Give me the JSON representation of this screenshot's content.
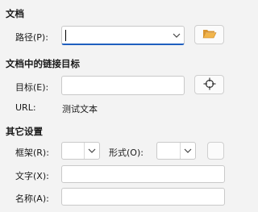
{
  "document": {
    "section_title": "文档",
    "path_label": "路径(P):",
    "path_value": ""
  },
  "target_section": {
    "section_title": "文档中的链接目标",
    "target_label": "目标(E):",
    "target_value": "",
    "url_label": "URL:",
    "url_value": "测试文本"
  },
  "other": {
    "section_title": "其它设置",
    "frame_label": "框架(R):",
    "frame_value": "",
    "form_label": "形式(O):",
    "form_value": "",
    "text_label": "文字(X):",
    "text_value": "",
    "name_label": "名称(A):",
    "name_value": ""
  },
  "icons": {
    "open_file": "folder-open-icon",
    "target_picker": "crosshair-target-icon",
    "dropdown": "chevron-down-icon"
  },
  "colors": {
    "background": "#f3f3f3",
    "accent": "#1f5fbf",
    "folder": "#e8a23a"
  }
}
